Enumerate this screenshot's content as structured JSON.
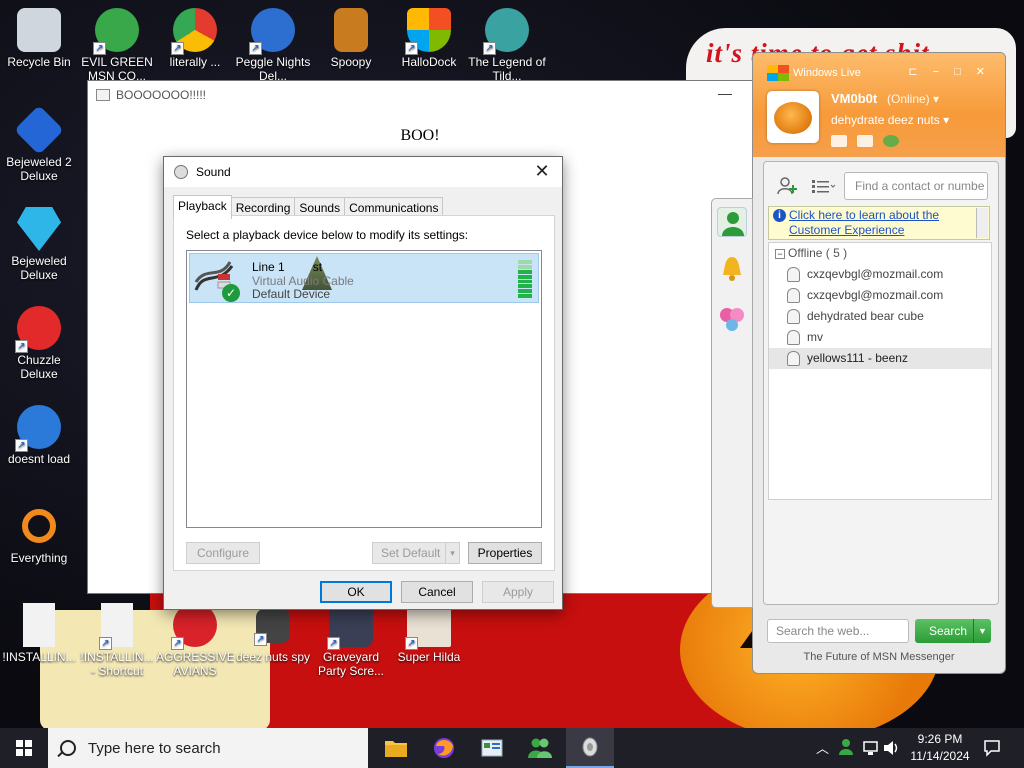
{
  "wallpaper": {
    "slogan": "it's time to get shit"
  },
  "desktop_icons": [
    {
      "label": "Recycle Bin",
      "icon": "recycle-bin-icon",
      "color": "#cfd6de"
    },
    {
      "label": "EVIL GREEN MSN CO...",
      "icon": "msn-buddies-icon",
      "color": "#39a84a"
    },
    {
      "label": "literally ...",
      "icon": "chrome-icon",
      "color": "#e33b2e"
    },
    {
      "label": "Peggle Nights Del...",
      "icon": "peggle-icon",
      "color": "#2d6fd1"
    },
    {
      "label": "Spoopy",
      "icon": "document-folder-icon",
      "color": "#c97c1f"
    },
    {
      "label": "HalloDock",
      "icon": "windows-shield-icon",
      "color": "#1e8be6"
    },
    {
      "label": "The Legend of Tild...",
      "icon": "legend-character-icon",
      "color": "#3aa2a0"
    },
    {
      "label": "Bejeweled 2 Deluxe",
      "icon": "bejeweled-2-icon",
      "color": "#2466d6"
    },
    {
      "label": "Bejeweled Deluxe",
      "icon": "diamond-icon",
      "color": "#2fb6e8"
    },
    {
      "label": "Chuzzle Deluxe",
      "icon": "chuzzle-icon",
      "color": "#e22a2a"
    },
    {
      "label": "doesnt load",
      "icon": "thunderbird-icon",
      "color": "#2b79d9"
    },
    {
      "label": "Everything",
      "icon": "everything-search-icon",
      "color": "#f08a1c"
    },
    {
      "label": "!INSTALLIN...",
      "icon": "text-document-icon",
      "color": "#f2f2f2"
    },
    {
      "label": "!INSTALLIN... - Shortcut",
      "icon": "text-document-shortcut-icon",
      "color": "#f2f2f2"
    },
    {
      "label": "AGGRESSIVE AVIANS",
      "icon": "angry-bird-icon",
      "color": "#d9222a"
    },
    {
      "label": "deez nuts spy",
      "icon": "windows-stack-icon",
      "color": "#444444"
    },
    {
      "label": "Graveyard Party Scre...",
      "icon": "graveyard-icon",
      "color": "#3a3f55"
    },
    {
      "label": "Super Hilda",
      "icon": "pixel-character-icon",
      "color": "#e9e1d3"
    }
  ],
  "boo_window": {
    "title": "BOOOOOOO!!!!!",
    "minimize": "—",
    "heading": "BOO!"
  },
  "sound_dialog": {
    "title": "Sound",
    "close": "✕",
    "tabs": [
      "Playback",
      "Recording",
      "Sounds",
      "Communications"
    ],
    "instruction": "Select a playback device below to modify its settings:",
    "device": {
      "name": "Line 1",
      "overlap": "st",
      "sub": "Virtual Audio Cable",
      "status": "Default Device",
      "level": 0.72
    },
    "buttons": {
      "configure": "Configure",
      "set_default": "Set Default",
      "properties": "Properties",
      "ok": "OK",
      "cancel": "Cancel",
      "apply": "Apply"
    }
  },
  "msn": {
    "brand": "Windows Live",
    "window_controls": "⊏ − □ ✕",
    "username": "VM0b0t",
    "status": "(Online) ▾",
    "personal_message": "dehydrate deez nuts ▾",
    "search_placeholder": "Find a contact or numbe",
    "info_link": "Click here to learn about the Customer Experience",
    "group": "Offline ( 5 )",
    "contacts": [
      "cxzqevbgl@mozmail.com",
      "cxzqevbgl@mozmail.com",
      "dehydrated bear cube",
      "mv",
      "yellows111 - beenz"
    ],
    "web_search_placeholder": "Search the web...",
    "search_button": "Search",
    "footer": "The Future of MSN Messenger",
    "accent": "#f79a3a"
  },
  "taskbar": {
    "search_placeholder": "Type here to search",
    "apps": [
      "file-explorer-icon",
      "firefox-icon",
      "control-panel-icon",
      "msn-messenger-icon",
      "sound-icon"
    ],
    "time": "9:26 PM",
    "date": "11/14/2024"
  }
}
